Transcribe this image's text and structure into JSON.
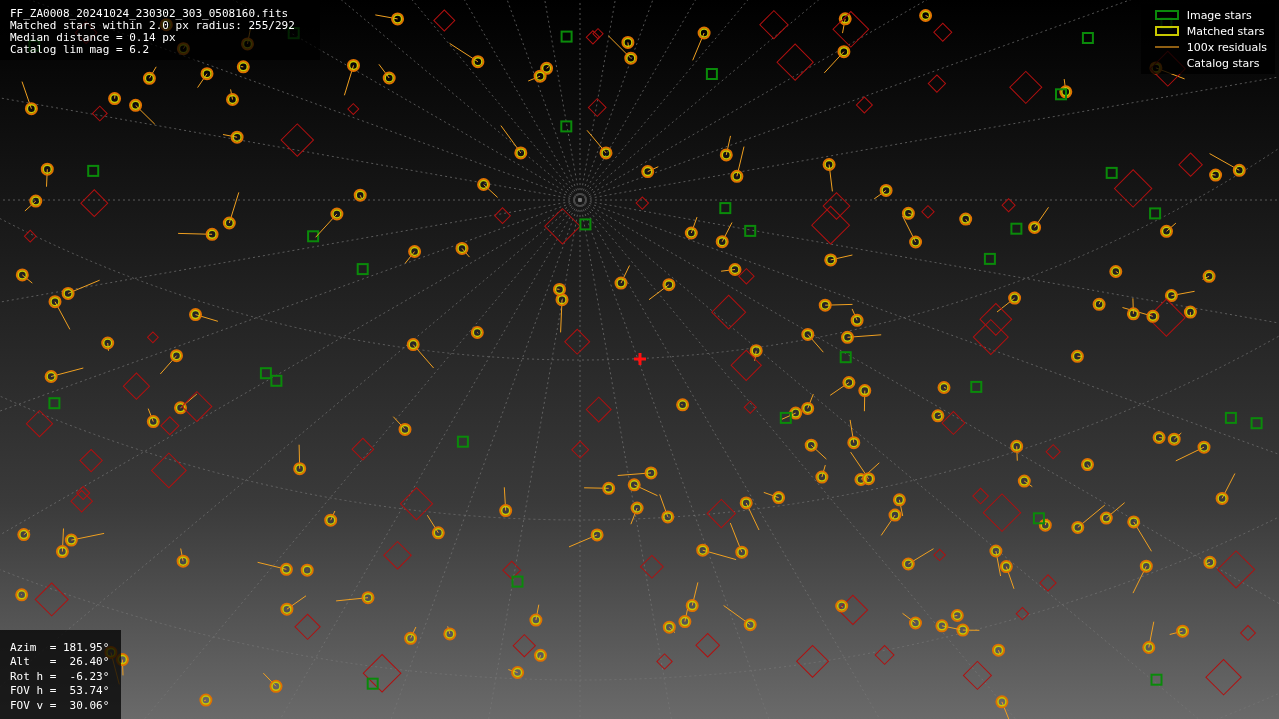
{
  "info": {
    "lines": [
      "FF_ZA0008_20241024_230302_303_0508160.fits",
      "Matched stars within 2.0 px radius: 255/292",
      "Median distance = 0.14 px",
      "Catalog lim mag = 6.2"
    ]
  },
  "legend": [
    {
      "kind": "image",
      "label": "Image stars"
    },
    {
      "kind": "matched",
      "label": "Matched stars"
    },
    {
      "kind": "residual",
      "label": "100x residuals"
    },
    {
      "kind": "catalog",
      "label": "Catalog stars"
    }
  ],
  "pointing": {
    "lines": [
      "Azim  = 181.95°",
      "Alt   =  26.40°",
      "Rot h =  -6.23°",
      "FOV h =  53.74°",
      "FOV v =  30.06°"
    ]
  }
}
